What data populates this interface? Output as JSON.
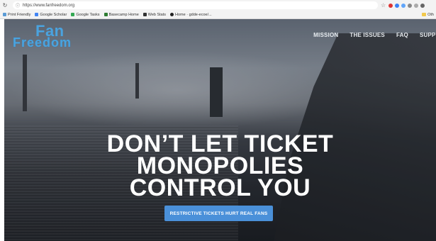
{
  "browser": {
    "url": "https://www.fanfreedom.org",
    "bookmarks": [
      {
        "label": "Print Friendly",
        "color": "#5b9bd5"
      },
      {
        "label": "Google Scholar",
        "color": "#4285f4"
      },
      {
        "label": "Google Tasks",
        "color": "#34a853"
      },
      {
        "label": "Basecamp Home",
        "color": "#2e7d32"
      },
      {
        "label": "Web Stats",
        "color": "#333333"
      },
      {
        "label": "Home · gdde-ecoe/...",
        "color": "#222222"
      }
    ],
    "other_bookmarks": "Oth"
  },
  "site": {
    "logo_top": "Fan",
    "logo_bottom": "Freedom",
    "brand_color": "#4aa3df",
    "nav": [
      "MISSION",
      "THE ISSUES",
      "FAQ",
      "SUPPO"
    ],
    "headline": [
      "DON’T LET TICKET",
      "MONOPOLIES",
      "CONTROL YOU"
    ],
    "cta_label": "RESTRICTIVE TICKETS HURT REAL FANS",
    "cta_color": "#4a90d9"
  }
}
